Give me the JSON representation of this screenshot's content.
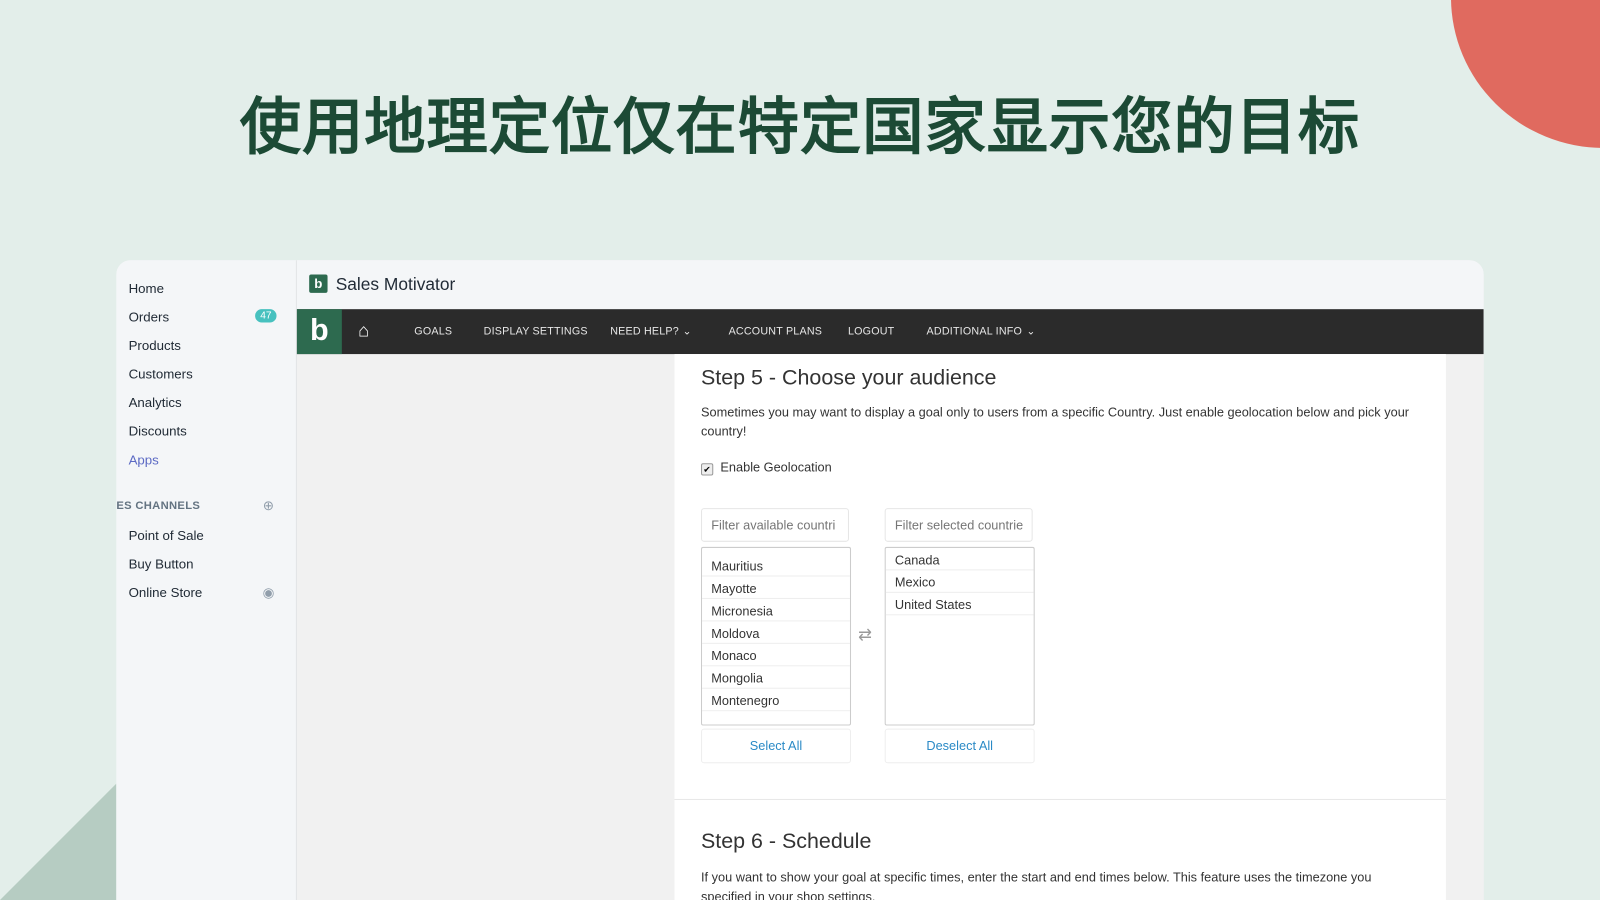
{
  "headline": "使用地理定位仅在特定国家显示您的目标",
  "colors": {
    "background": "#e3eeea",
    "headline": "#1c4a35",
    "accent_circle": "#e06a5f",
    "brand": "#2d6a4f",
    "nav": "#2b2b2b",
    "link": "#2a8ac6"
  },
  "sidebar": {
    "items": [
      {
        "label": "Home"
      },
      {
        "label": "Orders",
        "badge": "47"
      },
      {
        "label": "Products"
      },
      {
        "label": "Customers"
      },
      {
        "label": "Analytics"
      },
      {
        "label": "Discounts"
      },
      {
        "label": "Apps",
        "active": true
      }
    ],
    "section_label": "ES CHANNELS",
    "section_icon": "plus-circle-icon",
    "channels": [
      {
        "label": "Point of Sale"
      },
      {
        "label": "Buy Button"
      },
      {
        "label": "Online Store",
        "icon": "eye-icon"
      }
    ]
  },
  "header": {
    "logo": "b",
    "title": "Sales Motivator"
  },
  "nav": {
    "brand": "b",
    "items": [
      {
        "label": "GOALS"
      },
      {
        "label": "DISPLAY SETTINGS"
      },
      {
        "label": "NEED HELP?"
      },
      {
        "label": "ACCOUNT PLANS"
      },
      {
        "label": "LOGOUT"
      },
      {
        "label": "ADDITIONAL INFO"
      }
    ]
  },
  "step5": {
    "title": "Step 5 - Choose your audience",
    "description": "Sometimes you may want to display a goal only to users from a specific Country. Just enable geolocation below and pick your country!",
    "checkbox_label": "Enable Geolocation",
    "checked": true,
    "available_placeholder": "Filter available countri",
    "selected_placeholder": "Filter selected countrie",
    "available": [
      "Mauritius",
      "Mayotte",
      "Micronesia",
      "Moldova",
      "Monaco",
      "Mongolia",
      "Montenegro"
    ],
    "selected": [
      "Canada",
      "Mexico",
      "United States"
    ],
    "select_all": "Select All",
    "deselect_all": "Deselect All"
  },
  "step6": {
    "title": "Step 6 - Schedule",
    "description": "If you want to show your goal at specific times, enter the start and end times below. This feature uses the timezone you specified in your shop settings."
  }
}
